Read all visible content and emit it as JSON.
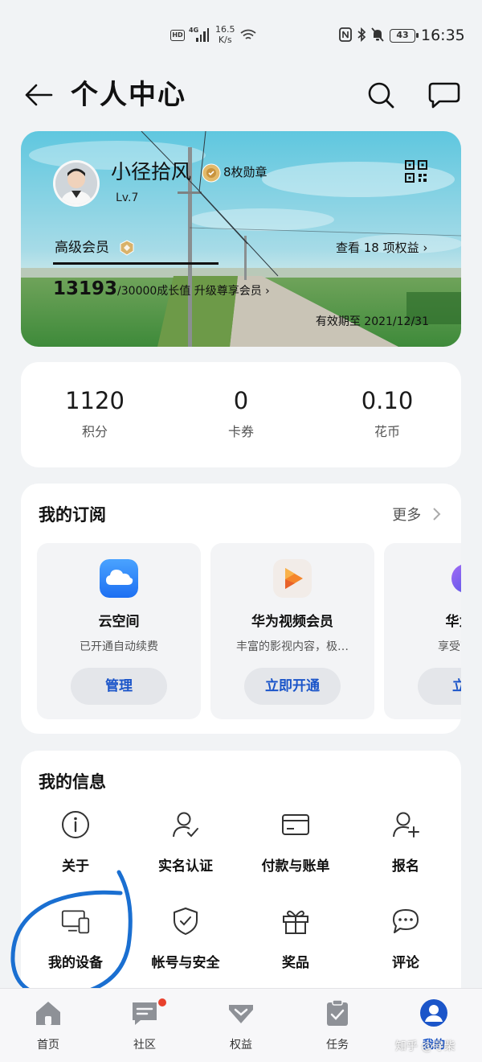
{
  "status_bar": {
    "hd": "HD",
    "network": "4G",
    "speed_value": "16.5",
    "speed_unit": "K/s",
    "battery": "43",
    "time": "16:35"
  },
  "header": {
    "title": "个人中心",
    "back_icon": "back-arrow-icon",
    "search_icon": "search-icon",
    "message_icon": "chat-bubble-icon"
  },
  "member_card": {
    "user_name": "小径拾风",
    "medals": "8枚勋章",
    "level": "Lv.7",
    "vip_label": "高级会员",
    "benefits_link": "查看 18 项权益 ›",
    "growth_current": "13193",
    "growth_rest": "/30000成长值 升级尊享会员 ›",
    "expiry": "有效期至 2021/12/31"
  },
  "points": [
    {
      "value": "1120",
      "label": "积分"
    },
    {
      "value": "0",
      "label": "卡券"
    },
    {
      "value": "0.10",
      "label": "花币"
    }
  ],
  "subscriptions": {
    "title": "我的订阅",
    "more": "更多",
    "items": [
      {
        "name": "云空间",
        "desc": "已开通自动续费",
        "button": "管理",
        "icon": "cloud-icon",
        "color": "#2f7cf6"
      },
      {
        "name": "华为视频会员",
        "desc": "丰富的影视内容，极…",
        "button": "立即开通",
        "icon": "video-play-icon",
        "color": "#f08a24"
      },
      {
        "name": "华为音",
        "desc": "享受高品…",
        "button": "立即",
        "icon": "music-icon",
        "color": "#6a4cf0"
      }
    ]
  },
  "my_info": {
    "title": "我的信息",
    "items": [
      {
        "label": "关于",
        "icon": "info-icon"
      },
      {
        "label": "实名认证",
        "icon": "user-verified-icon"
      },
      {
        "label": "付款与账单",
        "icon": "card-icon"
      },
      {
        "label": "报名",
        "icon": "user-add-icon"
      },
      {
        "label": "我的设备",
        "icon": "devices-icon"
      },
      {
        "label": "帐号与安全",
        "icon": "shield-check-icon"
      },
      {
        "label": "奖品",
        "icon": "gift-icon"
      },
      {
        "label": "评论",
        "icon": "comment-icon"
      }
    ]
  },
  "bottom_nav": {
    "items": [
      {
        "label": "首页",
        "icon": "home-icon"
      },
      {
        "label": "社区",
        "icon": "community-icon"
      },
      {
        "label": "权益",
        "icon": "benefits-icon"
      },
      {
        "label": "任务",
        "icon": "task-icon"
      },
      {
        "label": "我的",
        "icon": "profile-icon"
      }
    ],
    "active": "我的"
  },
  "watermark": "知乎 @寻柴",
  "colors": {
    "accent": "#1b55c9",
    "background": "#f1f3f5",
    "annotation": "#1a6fd1"
  }
}
